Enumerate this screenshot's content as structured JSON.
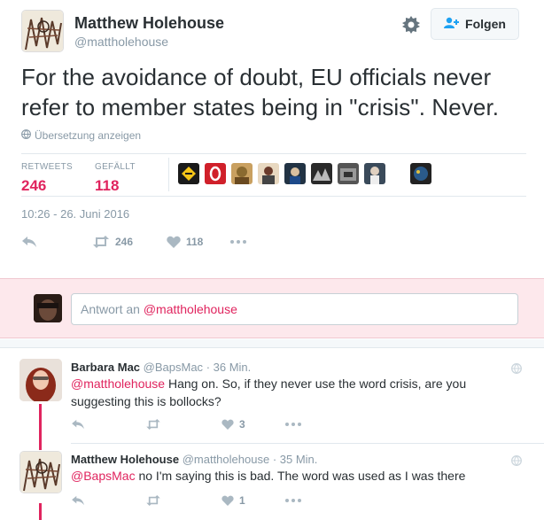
{
  "author": {
    "name": "Matthew Holehouse",
    "handle": "@mattholehouse",
    "follow_label": "Folgen"
  },
  "tweet": {
    "text": "For the avoidance of doubt, EU officials never refer to member states being in \"crisis\".  Never.",
    "translate_label": "Übersetzung anzeigen",
    "timestamp": "10:26 - 26. Juni 2016"
  },
  "stats": {
    "retweets_label": "RETWEETS",
    "retweets": "246",
    "likes_label": "GEFÄLLT",
    "likes": "118"
  },
  "actions": {
    "retweet_count": "246",
    "like_count": "118"
  },
  "reply_box": {
    "prefix": "Antwort an ",
    "mention": "@mattholehouse"
  },
  "replies": [
    {
      "name": "Barbara Mac",
      "handle": "@BapsMac",
      "time": "· 36 Min.",
      "mention": "@mattholehouse",
      "text": " Hang on. So, if they never use the word crisis, are you suggesting this is bollocks?",
      "like_count": "3"
    },
    {
      "name": "Matthew Holehouse",
      "handle": "@mattholehouse",
      "time": "· 35 Min.",
      "mention": "@BapsMac",
      "text": " no I'm saying this is bad. The word was used as I was there",
      "like_count": "1"
    }
  ],
  "colors": {
    "accent": "#e0245e",
    "muted": "#8899a6",
    "text": "#292f33",
    "reply_bg": "#fde8ec"
  }
}
